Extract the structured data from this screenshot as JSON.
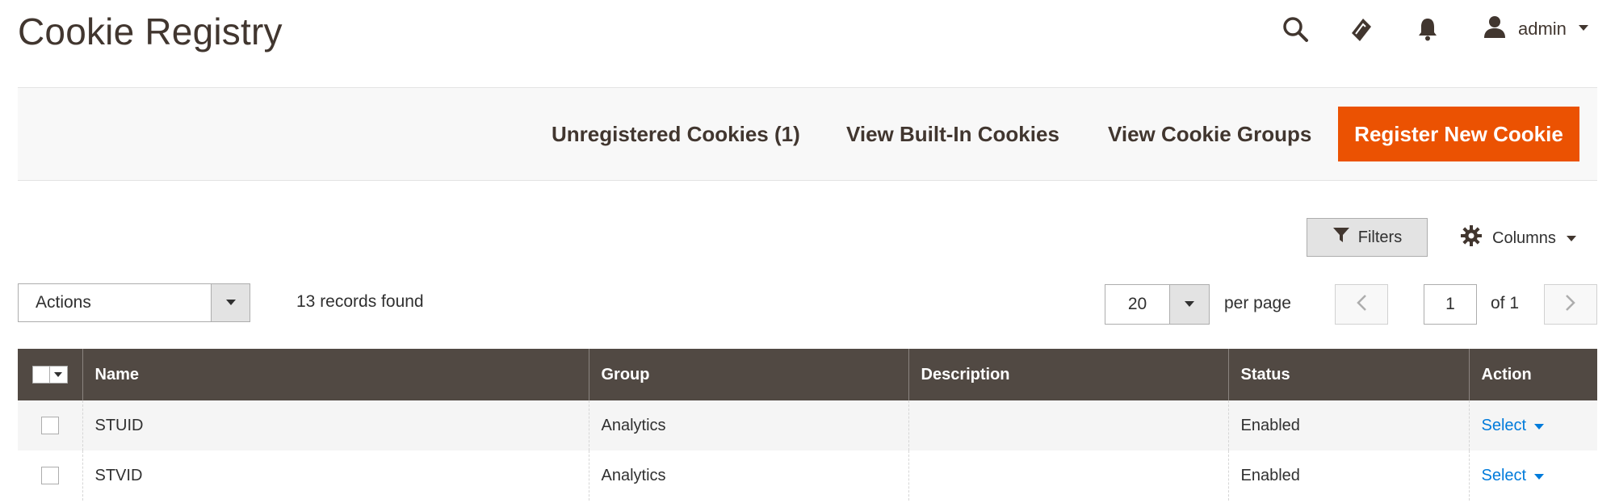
{
  "header": {
    "title": "Cookie Registry",
    "user_name": "admin",
    "icons": [
      "search-icon",
      "bolt-icon",
      "bell-icon",
      "user-icon",
      "chevron-down-icon"
    ]
  },
  "action_bar": {
    "unregistered_label": "Unregistered Cookies (1)",
    "builtin_label": "View Built-In Cookies",
    "groups_label": "View Cookie Groups",
    "register_label": "Register New Cookie",
    "accent_color": "#eb5202"
  },
  "toolbar": {
    "filters_label": "Filters",
    "columns_label": "Columns",
    "actions_label": "Actions",
    "records_found": "13 records found",
    "per_page_value": "20",
    "per_page_label": "per page",
    "current_page": "1",
    "of_label": "of 1"
  },
  "grid": {
    "columns": [
      "Name",
      "Group",
      "Description",
      "Status",
      "Action"
    ],
    "rows": [
      {
        "name": "STUID",
        "group": "Analytics",
        "description": "",
        "status": "Enabled",
        "action": "Select"
      },
      {
        "name": "STVID",
        "group": "Analytics",
        "description": "",
        "status": "Enabled",
        "action": "Select"
      }
    ],
    "header_color": "#514943",
    "link_color": "#007bdb"
  }
}
